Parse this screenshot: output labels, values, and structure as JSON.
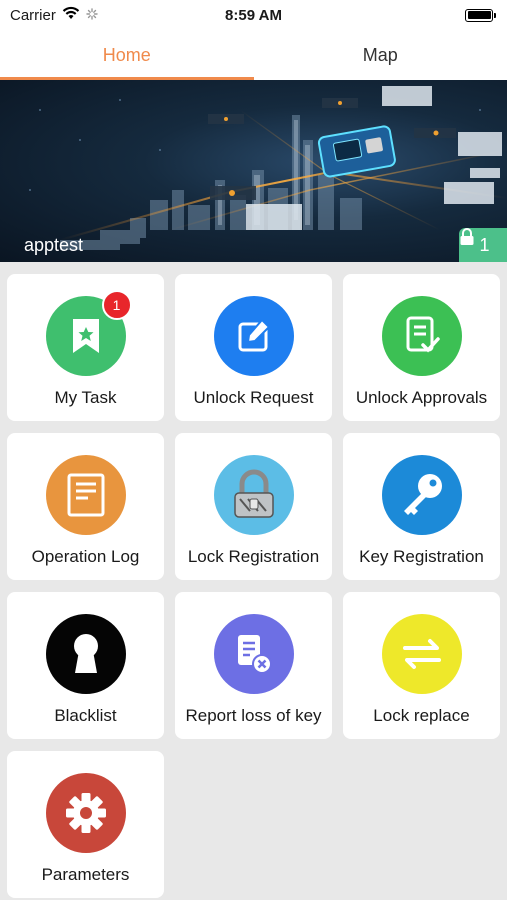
{
  "status_bar": {
    "carrier": "Carrier",
    "time": "8:59 AM"
  },
  "tabs": [
    {
      "label": "Home",
      "active": true
    },
    {
      "label": "Map",
      "active": false
    }
  ],
  "banner": {
    "label": "apptest",
    "lock_count": "1"
  },
  "colors": {
    "accent": "#f08a4b",
    "badge": "#4cc08a",
    "notification": "#e8262b"
  },
  "menu": [
    {
      "label": "My Task",
      "icon": "task-flag-icon",
      "color": "#3fbf6e",
      "badge": "1"
    },
    {
      "label": "Unlock Request",
      "icon": "edit-request-icon",
      "color": "#1e7ef0"
    },
    {
      "label": "Unlock Approvals",
      "icon": "approval-document-icon",
      "color": "#3cc054"
    },
    {
      "label": "Operation Log",
      "icon": "log-document-icon",
      "color": "#e8953e"
    },
    {
      "label": "Lock Registration",
      "icon": "padlock-icon",
      "color": "#5cbde6"
    },
    {
      "label": "Key Registration",
      "icon": "key-icon",
      "color": "#1c8ad8"
    },
    {
      "label": "Blacklist",
      "icon": "keyhole-icon",
      "color": "#050505"
    },
    {
      "label": "Report loss of key",
      "icon": "report-loss-icon",
      "color": "#6d6fe4"
    },
    {
      "label": "Lock replace",
      "icon": "swap-arrows-icon",
      "color": "#eee82a"
    },
    {
      "label": "Parameters",
      "icon": "gear-icon",
      "color": "#c8473a"
    }
  ]
}
